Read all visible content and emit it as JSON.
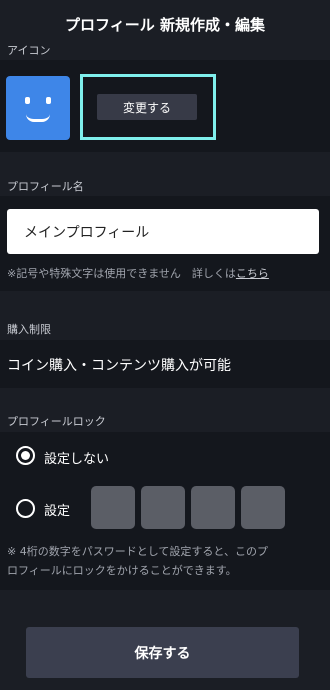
{
  "page_title": "プロフィール 新規作成・編集",
  "icon_section": {
    "label": "アイコン",
    "change_button": "変更する"
  },
  "name_section": {
    "label": "プロフィール名",
    "value": "メインプロフィール",
    "note_text": "※記号や特殊文字は使用できません　詳しくは",
    "note_link": "こちら"
  },
  "purchase_section": {
    "label": "購入制限",
    "value": "コイン購入・コンテンツ購入が可能"
  },
  "lock_section": {
    "label": "プロフィールロック",
    "option_off": "設定しない",
    "option_on": "設定",
    "note_line1": "※ 4桁の数字をパスワードとして設定すると、このプ",
    "note_line2": "ロフィールにロックをかけることができます。"
  },
  "save_button": "保存する",
  "colors": {
    "background": "#1b1e25",
    "panel": "#14171d",
    "accent_highlight": "#7fefec",
    "avatar_blue": "#3e86e8"
  }
}
